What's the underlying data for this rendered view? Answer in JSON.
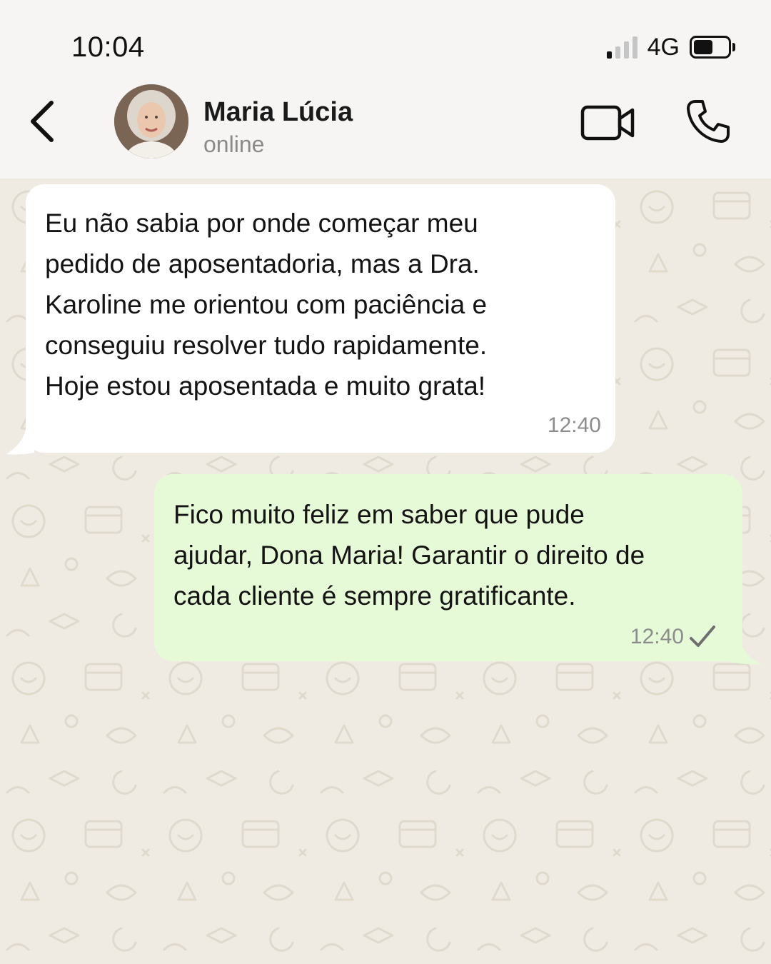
{
  "status_bar": {
    "time": "10:04",
    "network": "4G",
    "signal_bars_active": 1,
    "signal_bars_total": 4,
    "battery_level": 0.45
  },
  "header": {
    "contact_name": "Maria Lúcia",
    "contact_status": "online",
    "icons": [
      "back-arrow-icon",
      "avatar",
      "video-call-icon",
      "phone-icon"
    ]
  },
  "messages": [
    {
      "direction": "incoming",
      "text": "Eu não sabia por onde começar meu\npedido de aposentadoria, mas a Dra.\nKaroline me orientou com paciência e\nconseguiu resolver tudo rapidamente.\nHoje estou aposentada e muito grata!",
      "time": "12:40"
    },
    {
      "direction": "outgoing",
      "text": "Fico muito feliz em saber que pude\najudar, Dona Maria! Garantir o direito de\ncada cliente é sempre gratificante.",
      "time": "12:40",
      "status": "sent-check-icon"
    }
  ],
  "colors": {
    "background": "#efeae2",
    "incoming_bubble": "#ffffff",
    "outgoing_bubble": "#e6fad8",
    "header": "#f6f5f3"
  }
}
